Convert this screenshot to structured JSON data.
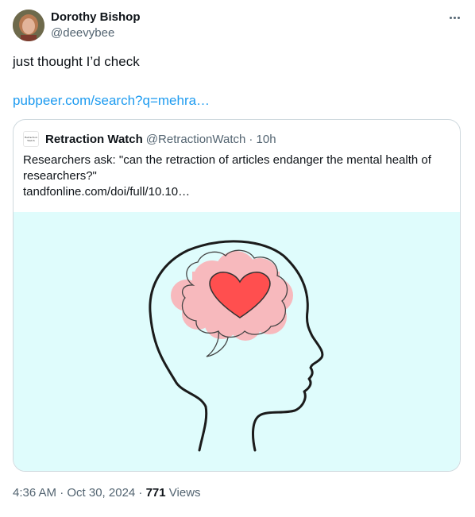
{
  "author": {
    "name": "Dorothy Bishop",
    "handle": "@deevybee"
  },
  "tweet": {
    "text": "just thought I’d check",
    "link_text": "pubpeer.com/search?q=mehra…"
  },
  "quoted": {
    "logo_text": "Retraction Watch",
    "name": "Retraction Watch",
    "handle": "@RetractionWatch",
    "time": "· 10h",
    "text_line1": "Researchers ask: \"can the retraction of articles endanger the mental health of researchers?\"",
    "text_link": "tandfonline.com/doi/full/10.10…",
    "image_icon": "brain-heart-head-illustration",
    "image_bg_color": "#dffcfc",
    "heart_color": "#ff4f4f",
    "brain_color": "#f7b9bd"
  },
  "meta": {
    "time": "4:36 AM · Oct 30, 2024 · ",
    "views_count": "771",
    "views_label": " Views"
  },
  "colors": {
    "link": "#1d9bf0",
    "secondary": "#536471",
    "border": "#cfd9de"
  }
}
